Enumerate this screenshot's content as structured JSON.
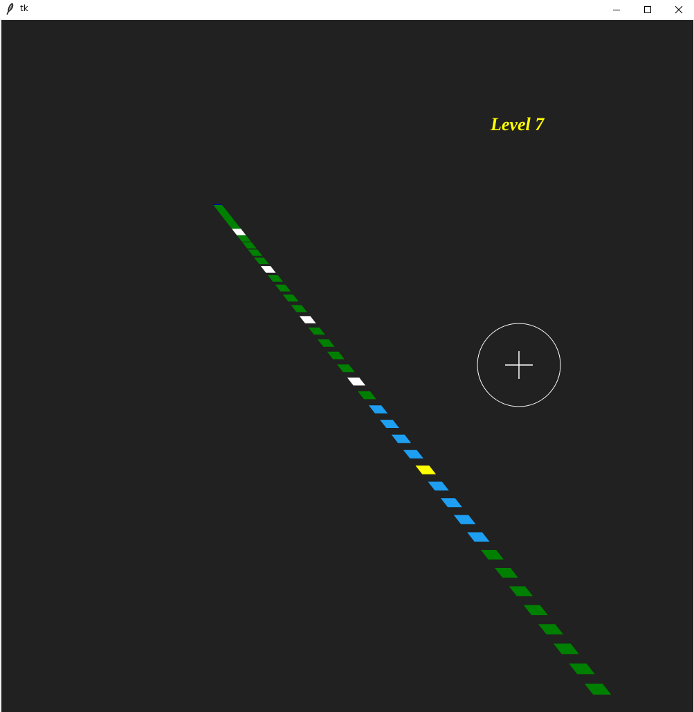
{
  "window": {
    "title": "tk",
    "icon": "feather-icon",
    "controls": [
      "minimize-icon",
      "maximize-icon",
      "close-icon"
    ]
  },
  "game": {
    "background_color": "#212121",
    "level_label": "Level 7",
    "level_label_color": "#ffff00",
    "crosshair_color": "#ffffff",
    "tile_colors": {
      "head": "#0000aa",
      "green": "#008000",
      "white": "#ffffff",
      "blue": "#1e9ff2",
      "yellow": "#ffff00"
    },
    "tiles": [
      "head",
      "green",
      "green",
      "green",
      "green",
      "green",
      "green",
      "white",
      "green",
      "green",
      "green",
      "green",
      "white",
      "green",
      "green",
      "green",
      "green",
      "white",
      "green",
      "green",
      "green",
      "green",
      "white",
      "green",
      "blue",
      "blue",
      "blue",
      "blue",
      "yellow",
      "blue",
      "blue",
      "blue",
      "blue",
      "green",
      "green",
      "green",
      "green",
      "green",
      "green",
      "green",
      "green"
    ]
  }
}
